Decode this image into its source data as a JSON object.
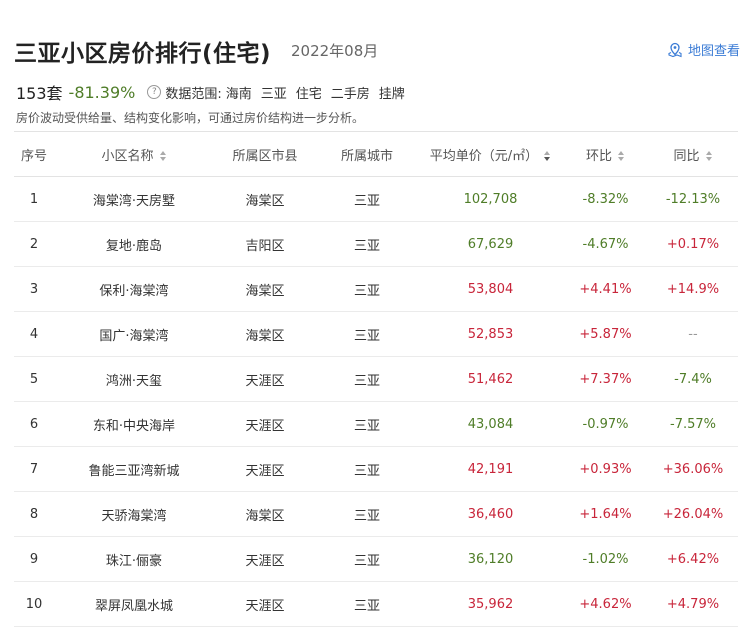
{
  "header": {
    "title": "三亚小区房价排行(住宅)",
    "date": "2022年08月",
    "map_link": "地图查看"
  },
  "summary": {
    "count": "153套",
    "change": "-81.39%",
    "help_icon": "?",
    "scope_label": "数据范围:",
    "tags": [
      "海南",
      "三亚",
      "住宅",
      "二手房",
      "挂牌"
    ],
    "note": "房价波动受供给量、结构变化影响，可通过房价结构进一步分析。"
  },
  "table": {
    "headers": [
      "序号",
      "小区名称",
      "所属区市县",
      "所属城市",
      "平均单价（元/㎡）",
      "环比",
      "同比"
    ],
    "rows": [
      {
        "rank": "1",
        "name": "海棠湾·天房墅",
        "district": "海棠区",
        "city": "三亚",
        "price": "102,708",
        "price_color": "green",
        "mom": "-8.32%",
        "mom_color": "green",
        "yoy": "-12.13%",
        "yoy_color": "green"
      },
      {
        "rank": "2",
        "name": "复地·鹿岛",
        "district": "吉阳区",
        "city": "三亚",
        "price": "67,629",
        "price_color": "green",
        "mom": "-4.67%",
        "mom_color": "green",
        "yoy": "+0.17%",
        "yoy_color": "red"
      },
      {
        "rank": "3",
        "name": "保利·海棠湾",
        "district": "海棠区",
        "city": "三亚",
        "price": "53,804",
        "price_color": "red",
        "mom": "+4.41%",
        "mom_color": "red",
        "yoy": "+14.9%",
        "yoy_color": "red"
      },
      {
        "rank": "4",
        "name": "国广·海棠湾",
        "district": "海棠区",
        "city": "三亚",
        "price": "52,853",
        "price_color": "red",
        "mom": "+5.87%",
        "mom_color": "red",
        "yoy": "--",
        "yoy_color": "gray"
      },
      {
        "rank": "5",
        "name": "鸿洲·天玺",
        "district": "天涯区",
        "city": "三亚",
        "price": "51,462",
        "price_color": "red",
        "mom": "+7.37%",
        "mom_color": "red",
        "yoy": "-7.4%",
        "yoy_color": "green"
      },
      {
        "rank": "6",
        "name": "东和·中央海岸",
        "district": "天涯区",
        "city": "三亚",
        "price": "43,084",
        "price_color": "green",
        "mom": "-0.97%",
        "mom_color": "green",
        "yoy": "-7.57%",
        "yoy_color": "green"
      },
      {
        "rank": "7",
        "name": "鲁能三亚湾新城",
        "district": "天涯区",
        "city": "三亚",
        "price": "42,191",
        "price_color": "red",
        "mom": "+0.93%",
        "mom_color": "red",
        "yoy": "+36.06%",
        "yoy_color": "red"
      },
      {
        "rank": "8",
        "name": "天骄海棠湾",
        "district": "海棠区",
        "city": "三亚",
        "price": "36,460",
        "price_color": "red",
        "mom": "+1.64%",
        "mom_color": "red",
        "yoy": "+26.04%",
        "yoy_color": "red"
      },
      {
        "rank": "9",
        "name": "珠江·俪豪",
        "district": "天涯区",
        "city": "三亚",
        "price": "36,120",
        "price_color": "green",
        "mom": "-1.02%",
        "mom_color": "green",
        "yoy": "+6.42%",
        "yoy_color": "red"
      },
      {
        "rank": "10",
        "name": "翠屏凤凰水城",
        "district": "天涯区",
        "city": "三亚",
        "price": "35,962",
        "price_color": "red",
        "mom": "+4.62%",
        "mom_color": "red",
        "yoy": "+4.79%",
        "yoy_color": "red"
      }
    ]
  }
}
